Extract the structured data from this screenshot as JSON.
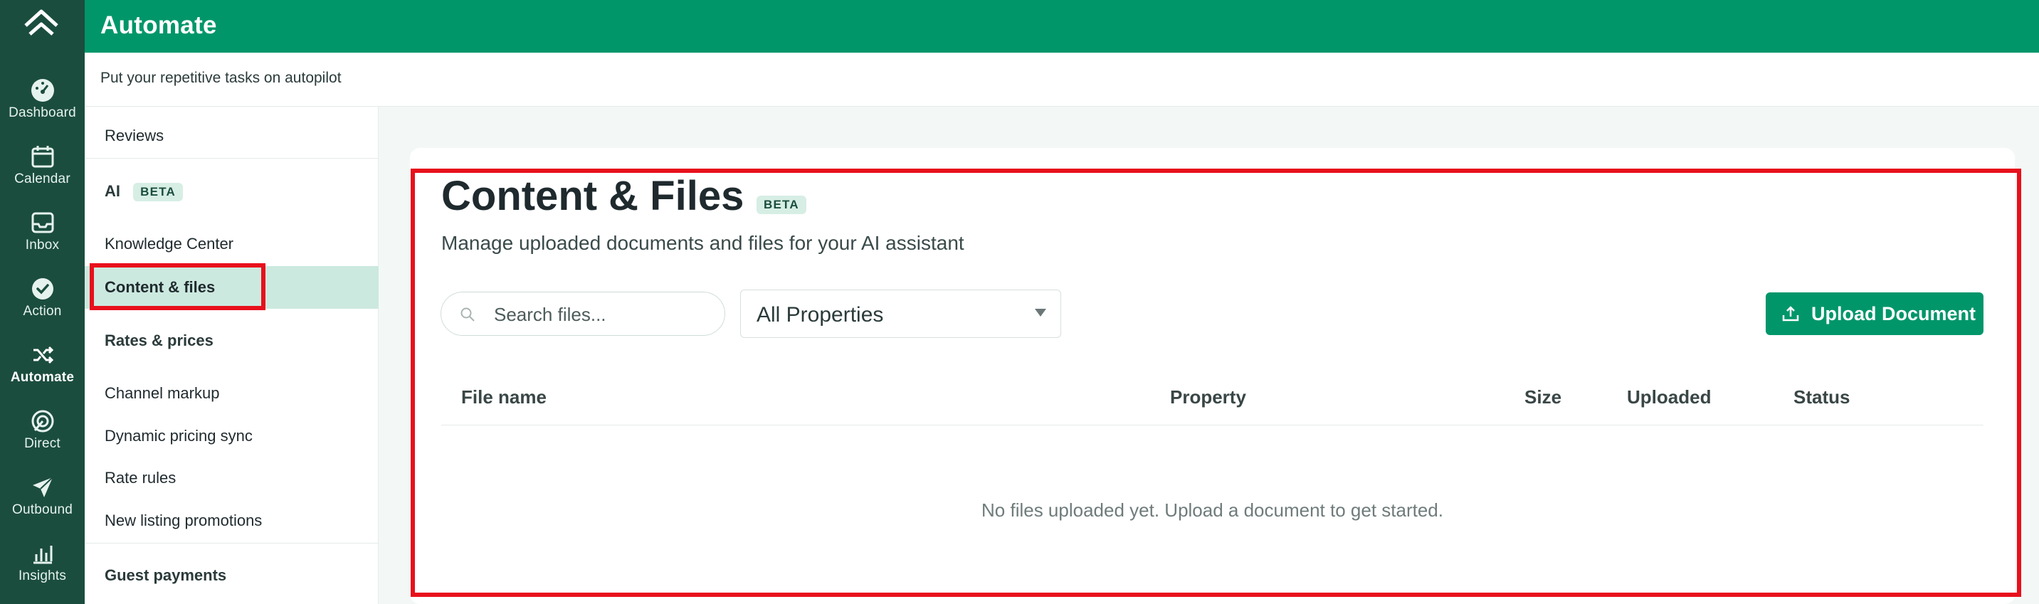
{
  "app": {
    "title": "Automate",
    "subtitle": "Put your repetitive tasks on autopilot"
  },
  "rail": {
    "items": [
      {
        "label": "Dashboard",
        "icon": "dashboard-gauge-icon"
      },
      {
        "label": "Calendar",
        "icon": "calendar-icon"
      },
      {
        "label": "Inbox",
        "icon": "inbox-tray-icon"
      },
      {
        "label": "Action",
        "icon": "check-circle-icon"
      },
      {
        "label": "Automate",
        "icon": "shuffle-icon",
        "active": true
      },
      {
        "label": "Direct",
        "icon": "direct-swirl-icon"
      },
      {
        "label": "Outbound",
        "icon": "paper-plane-icon"
      },
      {
        "label": "Insights",
        "icon": "chart-bars-icon"
      }
    ]
  },
  "subnav": {
    "reviews": "Reviews",
    "ai_group": "AI",
    "ai_badge": "BETA",
    "knowledge_center": "Knowledge Center",
    "content_files": "Content & files",
    "rates_group": "Rates & prices",
    "channel_markup": "Channel markup",
    "dynamic_pricing": "Dynamic pricing sync",
    "rate_rules": "Rate rules",
    "new_listing": "New listing promotions",
    "guest_payments": "Guest payments"
  },
  "main": {
    "title": "Content & Files",
    "title_badge": "BETA",
    "description": "Manage uploaded documents and files for your AI assistant",
    "search_placeholder": "Search files...",
    "property_select": "All Properties",
    "upload_label": "Upload Document",
    "columns": [
      "File name",
      "Property",
      "Size",
      "Uploaded",
      "Status"
    ],
    "empty_message": "No files uploaded yet. Upload a document to get started."
  },
  "colors": {
    "brand_green": "#00966a",
    "rail_dark": "#1b4d3e",
    "highlight_red": "#e8101c",
    "active_nav_bg": "#cce9df"
  }
}
